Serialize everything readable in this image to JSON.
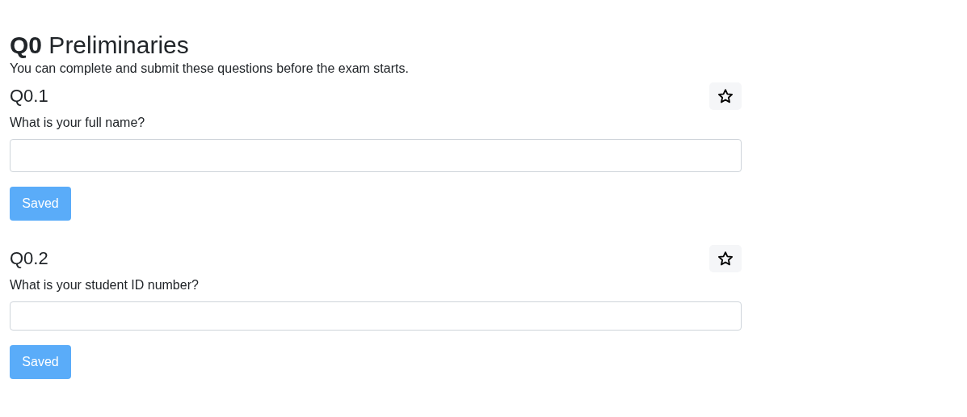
{
  "section": {
    "title": "**Q0** Preliminaries",
    "intro": "You can complete and submit these questions before the exam starts."
  },
  "questions": [
    {
      "number": "Q0.1",
      "starred": false,
      "prompt": "What is your full name?",
      "button": {
        "label": "Saved",
        "disabled": true
      }
    },
    {
      "number": "Q0.2",
      "starred": false,
      "prompt": "What is your student ID number?",
      "button": {
        "label": "Saved",
        "disabled": true
      }
    }
  ]
}
